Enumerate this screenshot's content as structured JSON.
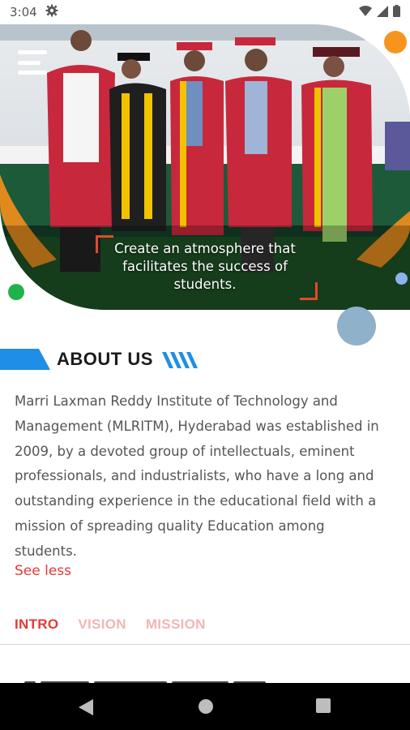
{
  "status_bar": {
    "time": "3:04"
  },
  "hero": {
    "caption_lines": [
      "Create an atmosphere that",
      "facilitates the success of",
      "students."
    ]
  },
  "about": {
    "title": "ABOUT US",
    "lines": [
      "Marri Laxman Reddy Institute of Technology and",
      "Management (MLRITM), Hyderabad was established in",
      "2009, by a devoted group of intellectuals, eminent",
      "professionals, and industrialists, who have a long and",
      "outstanding experience in the educational field with a",
      "mission of spreading quality Education among",
      "students."
    ],
    "see_less": "See less"
  },
  "tabs": [
    {
      "label": "INTRO",
      "active": true
    },
    {
      "label": "VISION",
      "active": false
    },
    {
      "label": "MISSION",
      "active": false
    }
  ],
  "colors": {
    "accent_red": "#e53935",
    "brand_blue": "#1f8ee6",
    "orange_dot": "#f7941d",
    "green_dot": "#22b24c"
  },
  "icons": {
    "menu": "hamburger-menu-icon",
    "settings": "gear-icon",
    "wifi": "wifi-icon",
    "signal": "signal-icon",
    "battery": "battery-icon",
    "back": "back-triangle-icon",
    "home": "home-circle-icon",
    "recents": "recents-square-icon"
  }
}
